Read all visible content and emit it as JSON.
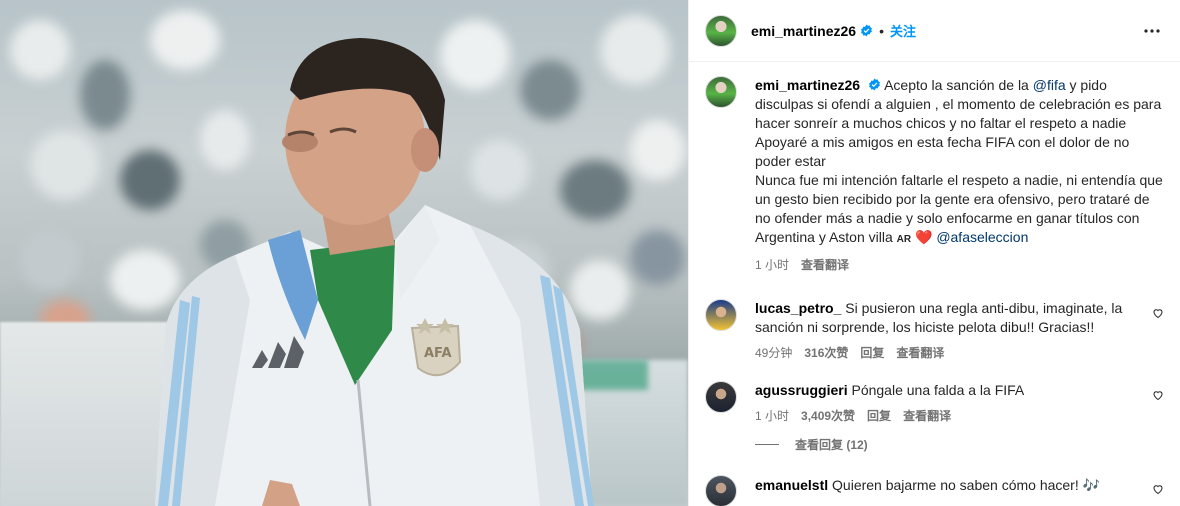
{
  "post": {
    "username": "emi_martinez26",
    "follow_label": "关注"
  },
  "caption": {
    "username": "emi_martinez26",
    "lines": [
      "Acepto la sanción de la ",
      " y pido disculpas si ofendí a alguien , el momento de celebración es para hacer sonreír a muchos chicos y no faltar el respeto a nadie",
      "Apoyaré a mis amigos en esta fecha FIFA con el dolor de no poder estar",
      "Nunca fue mi intención faltarle el respeto a nadie, ni entendía que un gesto bien recibido por la gente era ofensivo, pero trataré de no ofender más a nadie y solo enfocarme en ganar títulos con Argentina y Aston villa "
    ],
    "mention_fifa": "@fifa",
    "flag": "AR",
    "heart_emoji": "❤️",
    "mention_afa": "@afaseleccion",
    "time": "1 小时",
    "translate": "查看翻译"
  },
  "comments": [
    {
      "username": "lucas_petro_",
      "text": "Si pusieron una regla anti-dibu, imaginate, la sanción ni sorprende, los hiciste pelota dibu!! Gracias!!",
      "time": "49分钟",
      "likes": "316次赞",
      "reply": "回复",
      "translate": "查看翻译"
    },
    {
      "username": "agussruggieri",
      "text": "Póngale una falda a la FIFA",
      "time": "1 小时",
      "likes": "3,409次赞",
      "reply": "回复",
      "translate": "查看翻译",
      "view_replies": "查看回复 (12)"
    },
    {
      "username": "emanuelstl",
      "text": "Quieren bajarme no saben cómo hacer! 🎶"
    }
  ],
  "icons": {
    "verified": "verified-badge-icon",
    "more": "more-options-icon",
    "like": "heart-outline-icon"
  },
  "colors": {
    "accent": "#0095f6",
    "verified": "#0095f6",
    "mention": "#00376b",
    "meta": "#737373",
    "heart": "#ed1c24"
  }
}
